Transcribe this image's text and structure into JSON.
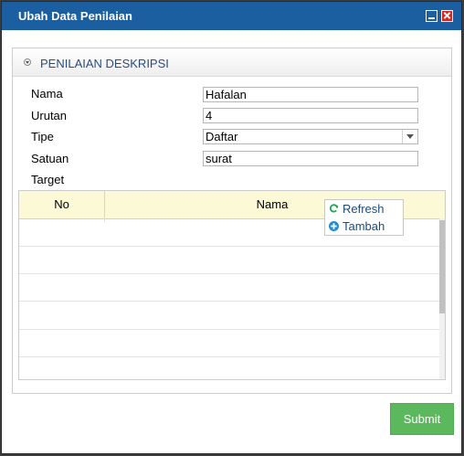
{
  "window": {
    "title": "Ubah Data Penilaian"
  },
  "panel": {
    "title": "PENILAIAN DESKRIPSI"
  },
  "form": {
    "nama": {
      "label": "Nama",
      "value": "Hafalan"
    },
    "urutan": {
      "label": "Urutan",
      "value": "4"
    },
    "tipe": {
      "label": "Tipe",
      "value": "Daftar"
    },
    "satuan": {
      "label": "Satuan",
      "value": "surat"
    },
    "target": {
      "label": "Target"
    }
  },
  "grid": {
    "columns": [
      "No",
      "Nama"
    ],
    "rows": []
  },
  "context_menu": {
    "items": [
      {
        "label": "Refresh",
        "icon": "refresh-icon"
      },
      {
        "label": "Tambah",
        "icon": "plus-circle-icon"
      }
    ]
  },
  "submit_label": "Submit",
  "colors": {
    "titlebar": "#1b5fa0",
    "submit": "#5cb85c",
    "grid_header": "#fbf9d6"
  }
}
